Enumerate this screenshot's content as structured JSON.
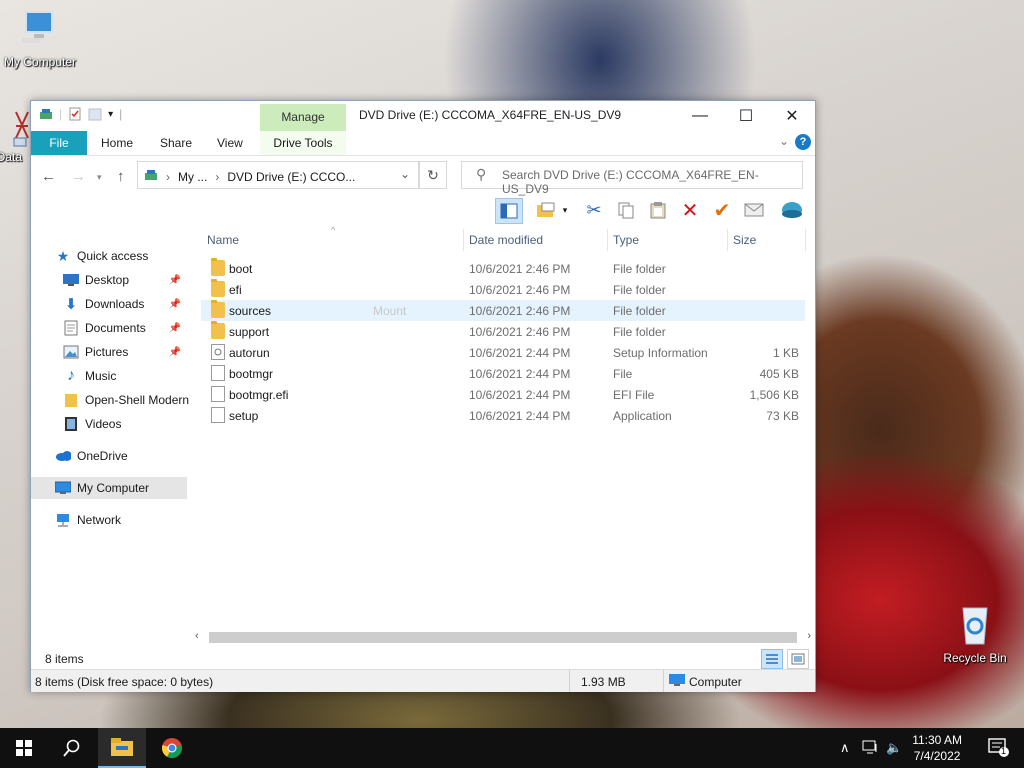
{
  "desktop": {
    "icons": [
      {
        "label": "My Computer"
      },
      {
        "label": "Data"
      },
      {
        "label": "Recycle Bin"
      }
    ]
  },
  "window": {
    "title": "DVD Drive (E:) CCCOMA_X64FRE_EN-US_DV9",
    "contextual_group": "Manage",
    "ribbon_tabs": [
      "File",
      "Home",
      "Share",
      "View",
      "Drive Tools"
    ],
    "caption": {
      "minimize": "—",
      "maximize": "☐",
      "close": "✕"
    },
    "help": "?"
  },
  "address": {
    "crumbs": [
      "My ...",
      "DVD Drive (E:) CCCO..."
    ],
    "search_placeholder": "Search DVD Drive (E:) CCCOMA_X64FRE_EN-US_DV9"
  },
  "nav": {
    "quick_access": "Quick access",
    "items": [
      {
        "label": "Desktop",
        "pinned": true,
        "icon": "desktop-icon"
      },
      {
        "label": "Downloads",
        "pinned": true,
        "icon": "download-icon"
      },
      {
        "label": "Documents",
        "pinned": true,
        "icon": "document-icon"
      },
      {
        "label": "Pictures",
        "pinned": true,
        "icon": "picture-icon"
      },
      {
        "label": "Music",
        "pinned": false,
        "icon": "music-icon"
      },
      {
        "label": "Open-Shell Modern",
        "pinned": false,
        "icon": "folder-icon"
      },
      {
        "label": "Videos",
        "pinned": false,
        "icon": "video-icon"
      }
    ],
    "onedrive": "OneDrive",
    "mycomputer": "My Computer",
    "network": "Network"
  },
  "columns": {
    "name": "Name",
    "date": "Date modified",
    "type": "Type",
    "size": "Size"
  },
  "files": [
    {
      "name": "boot",
      "date": "10/6/2021 2:46 PM",
      "type": "File folder",
      "size": "",
      "kind": "folder"
    },
    {
      "name": "efi",
      "date": "10/6/2021 2:46 PM",
      "type": "File folder",
      "size": "",
      "kind": "folder"
    },
    {
      "name": "sources",
      "date": "10/6/2021 2:46 PM",
      "type": "File folder",
      "size": "",
      "kind": "folder",
      "hover": true,
      "ghost": "Mount"
    },
    {
      "name": "support",
      "date": "10/6/2021 2:46 PM",
      "type": "File folder",
      "size": "",
      "kind": "folder"
    },
    {
      "name": "autorun",
      "date": "10/6/2021 2:44 PM",
      "type": "Setup Information",
      "size": "1 KB",
      "kind": "setup"
    },
    {
      "name": "bootmgr",
      "date": "10/6/2021 2:44 PM",
      "type": "File",
      "size": "405 KB",
      "kind": "file"
    },
    {
      "name": "bootmgr.efi",
      "date": "10/6/2021 2:44 PM",
      "type": "EFI File",
      "size": "1,506 KB",
      "kind": "file"
    },
    {
      "name": "setup",
      "date": "10/6/2021 2:44 PM",
      "type": "Application",
      "size": "73 KB",
      "kind": "file"
    }
  ],
  "status": {
    "item_count": "8 items",
    "details": "8 items (Disk free space: 0 bytes)",
    "size": "1.93 MB",
    "location": "Computer"
  },
  "taskbar": {
    "time": "11:30 AM",
    "date": "7/4/2022",
    "notifications": "1"
  },
  "colors": {
    "accent": "#19a0ba",
    "manage": "#ccecbc",
    "taskbar": "#101010",
    "selection": "#e5f3ff"
  }
}
